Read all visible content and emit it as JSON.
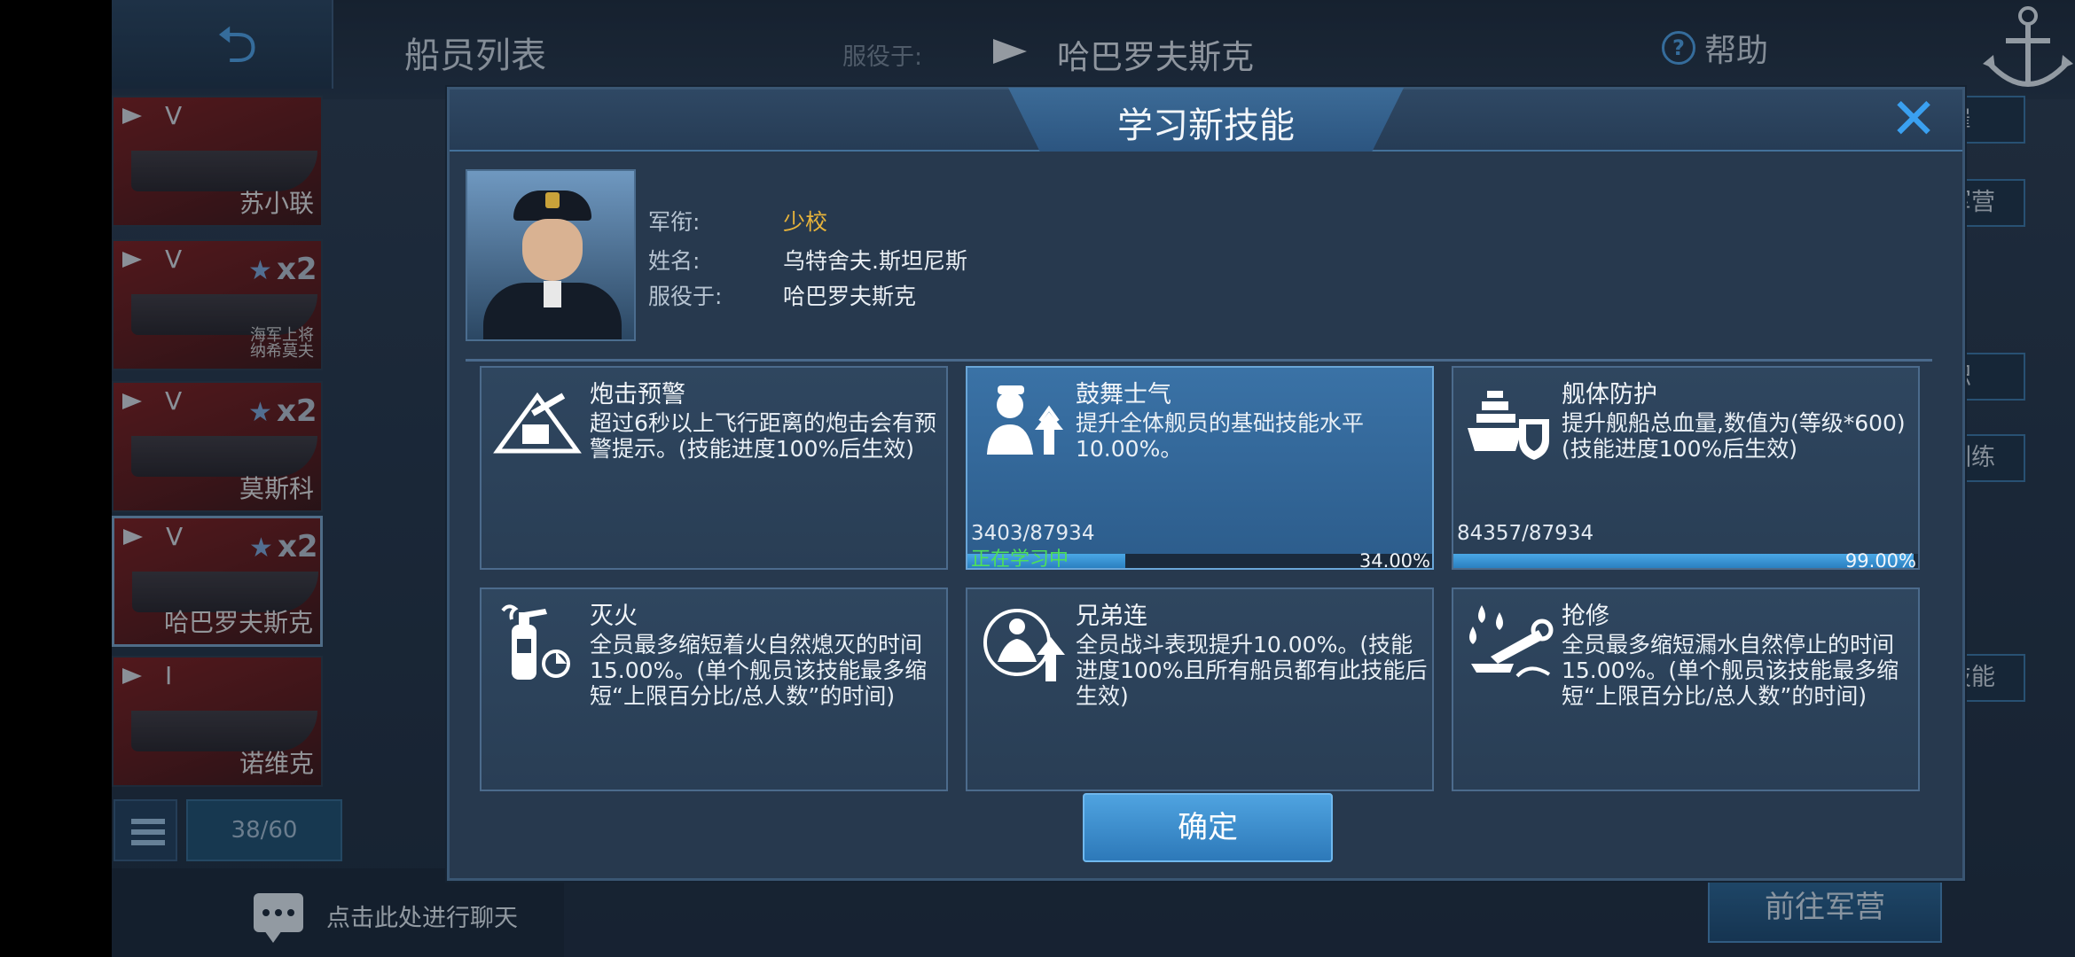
{
  "header": {
    "crew_list_title": "船员列表",
    "serving_label": "服役于:",
    "serving_ship": "哈巴罗夫斯克",
    "help_label": "帮助"
  },
  "crew_list": [
    {
      "rank": "V",
      "name": "苏小联",
      "stars": "",
      "multiplier": "",
      "extra": ""
    },
    {
      "rank": "V",
      "name": "",
      "stars": "★",
      "multiplier": "x2",
      "extra": "海军上将\n纳希莫夫"
    },
    {
      "rank": "V",
      "name": "莫斯科",
      "stars": "★",
      "multiplier": "x2",
      "extra": ""
    },
    {
      "rank": "V",
      "name": "哈巴罗夫斯克",
      "stars": "★",
      "multiplier": "x2",
      "extra": ""
    },
    {
      "rank": "I",
      "name": "诺维克",
      "stars": "",
      "multiplier": "",
      "extra": ""
    }
  ],
  "crew_count": "38/60",
  "chat_prompt": "点击此处进行聊天",
  "right_buttons": {
    "dismiss": "解雇",
    "recall": "调回军营",
    "transfer": "转职",
    "intensive_training": "强化训练",
    "reset_skills": "重置技能",
    "goto_barracks": "前往军营"
  },
  "modal": {
    "title": "学习新技能",
    "profile": {
      "rank_label": "军衔:",
      "rank_value": "少校",
      "name_label": "姓名:",
      "name_value": "乌特舍夫.斯坦尼斯",
      "serving_label": "服役于:",
      "serving_value": "哈巴罗夫斯克"
    },
    "skills": [
      {
        "name": "炮击预警",
        "desc": "超过6秒以上飞行距离的炮击会有预警提示。(技能进度100%后生效)",
        "icon": "artillery-warning-icon",
        "progress_text": "",
        "progress": 0,
        "percent": "",
        "status": ""
      },
      {
        "name": "鼓舞士气",
        "desc": "提升全体舰员的基础技能水平10.00%。",
        "icon": "morale-boost-icon",
        "progress_text": "3403/87934",
        "progress": 0.34,
        "percent": "34.00%",
        "status": "正在学习中"
      },
      {
        "name": "舰体防护",
        "desc": "提升舰船总血量,数值为(等级*600)(技能进度100%后生效)",
        "icon": "hull-protection-icon",
        "progress_text": "84357/87934",
        "progress": 0.99,
        "percent": "99.00%",
        "status": ""
      },
      {
        "name": "灭火",
        "desc": "全员最多缩短着火自然熄灭的时间15.00%。(单个舰员该技能最多缩短“上限百分比/总人数”的时间)",
        "icon": "fire-extinguisher-icon",
        "progress_text": "",
        "progress": 0,
        "percent": "",
        "status": ""
      },
      {
        "name": "兄弟连",
        "desc": "全员战斗表现提升10.00%。(技能进度100%且所有船员都有此技能后生效)",
        "icon": "band-of-brothers-icon",
        "progress_text": "",
        "progress": 0,
        "percent": "",
        "status": ""
      },
      {
        "name": "抢修",
        "desc": "全员最多缩短漏水自然停止的时间15.00%。(单个舰员该技能最多缩短“上限百分比/总人数”的时间)",
        "icon": "repair-icon",
        "progress_text": "",
        "progress": 0,
        "percent": "",
        "status": ""
      }
    ],
    "confirm_label": "确定"
  },
  "colors": {
    "accent": "#3aa0f0",
    "rank_gold": "#e8b43a",
    "learning_green": "#4ee05a"
  }
}
